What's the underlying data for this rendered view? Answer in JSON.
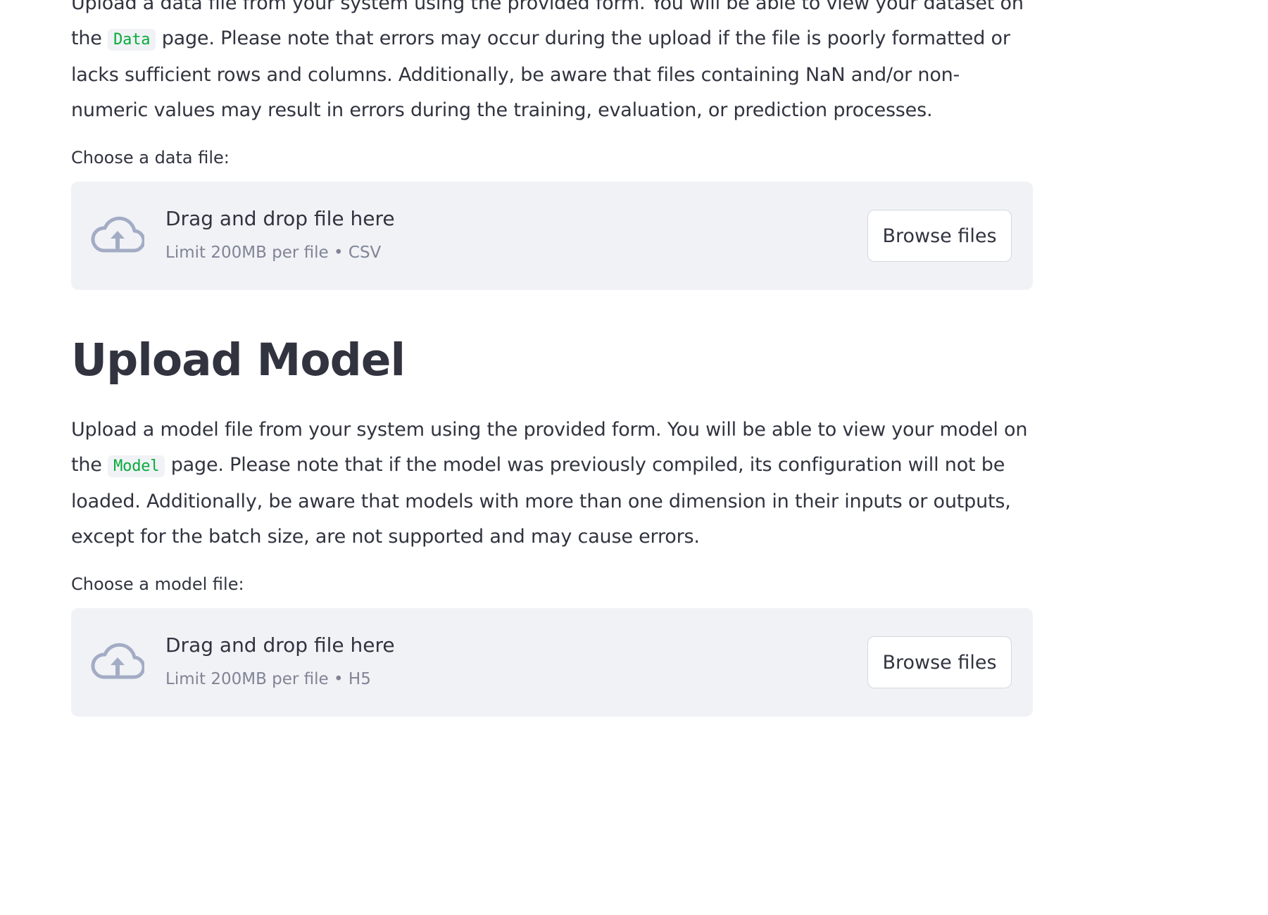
{
  "data_section": {
    "para_part1": "Upload a data file from your system using the provided form. You will be able to view your dataset on the",
    "code": "Data",
    "para_part2": "page. Please note that errors may occur during the upload if the file is poorly formatted or lacks sufficient rows and columns. Additionally, be aware that files containing NaN and/or non-numeric values may result in errors during the training, evaluation, or prediction processes.",
    "label": "Choose a data file:",
    "uploader": {
      "title": "Drag and drop file here",
      "limit": "Limit 200MB per file • CSV",
      "browse_label": "Browse files"
    }
  },
  "model_section": {
    "heading": "Upload Model",
    "para_part1": "Upload a model file from your system using the provided form. You will be able to view your model on the",
    "code": "Model",
    "para_part2": "page. Please note that if the model was previously compiled, its configuration will not be loaded. Additionally, be aware that models with more than one dimension in their inputs or outputs, except for the batch size, are not supported and may cause errors.",
    "label": "Choose a model file:",
    "uploader": {
      "title": "Drag and drop file here",
      "limit": "Limit 200MB per file • H5",
      "browse_label": "Browse files"
    }
  },
  "icons": {
    "upload": "cloud-upload-icon"
  },
  "colors": {
    "code_text": "#09ab3b",
    "code_bg": "#f0f2f6",
    "dropzone_bg": "#f0f2f6",
    "icon": "#a3acc4",
    "text": "#31333f",
    "muted": "#808495"
  }
}
